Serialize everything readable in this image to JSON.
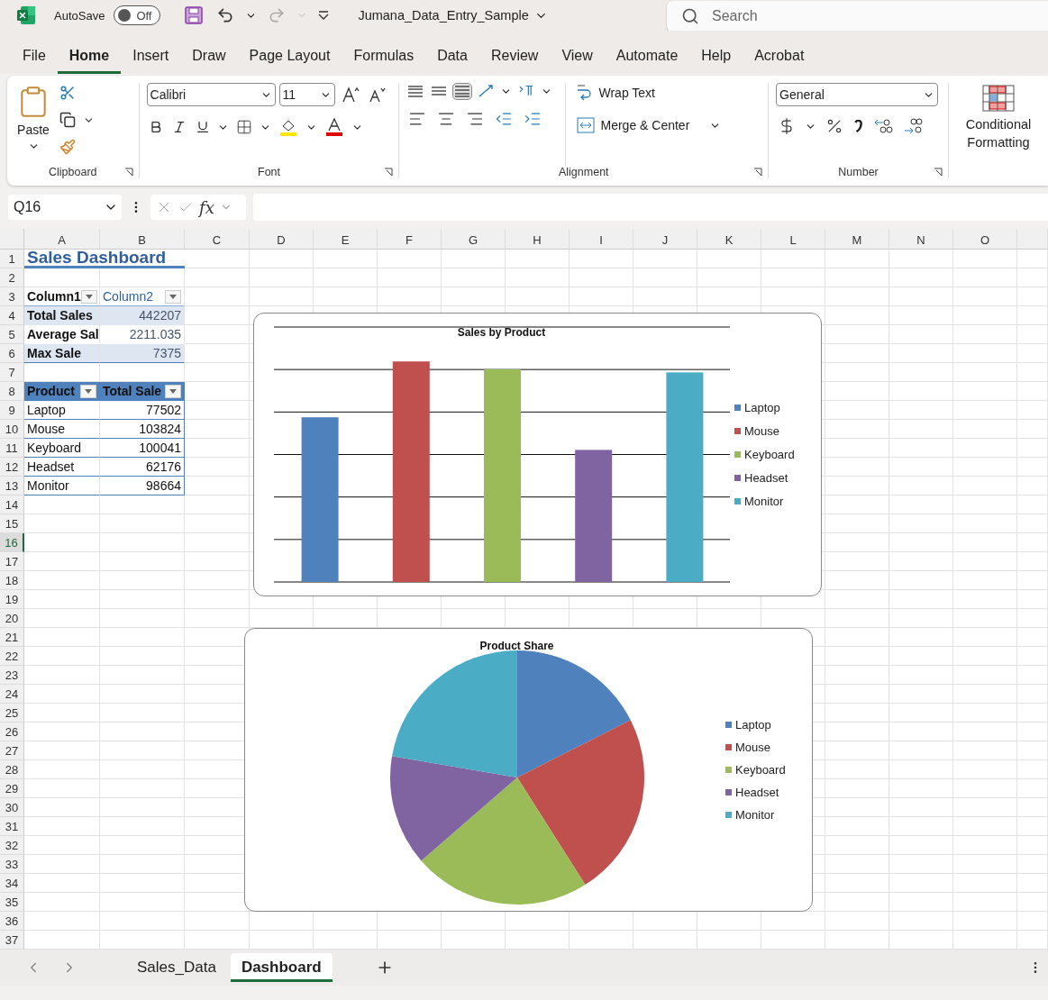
{
  "title_bar": {
    "autosave": {
      "label": "AutoSave",
      "on": false,
      "state_label": "Off"
    },
    "file_name": "Jumana_Data_Entry_Sample",
    "search": {
      "placeholder": "Search"
    }
  },
  "menu_tabs": [
    {
      "label": "File",
      "selected": false
    },
    {
      "label": "Home",
      "selected": true
    },
    {
      "label": "Insert",
      "selected": false
    },
    {
      "label": "Draw",
      "selected": false
    },
    {
      "label": "Page Layout",
      "selected": false
    },
    {
      "label": "Formulas",
      "selected": false
    },
    {
      "label": "Data",
      "selected": false
    },
    {
      "label": "Review",
      "selected": false
    },
    {
      "label": "View",
      "selected": false
    },
    {
      "label": "Automate",
      "selected": false
    },
    {
      "label": "Help",
      "selected": false
    },
    {
      "label": "Acrobat",
      "selected": false
    }
  ],
  "ribbon": {
    "clipboard": {
      "paste_label": "Paste",
      "group_label": "Clipboard"
    },
    "font": {
      "font_name": "Calibri",
      "font_size": "11",
      "group_label": "Font"
    },
    "alignment": {
      "vertical_align": [
        {
          "selected": false
        },
        {
          "selected": false
        },
        {
          "selected": true
        }
      ],
      "wrap_text": "Wrap Text",
      "merge_center": "Merge & Center",
      "group_label": "Alignment"
    },
    "number": {
      "format": "General",
      "group_label": "Number"
    },
    "styles": {
      "conditional_formatting": "Conditional Formatting"
    }
  },
  "formula_bar": {
    "name_box": "Q16",
    "function_label": "fx"
  },
  "sheet": {
    "columns": [
      "A",
      "B",
      "C",
      "D",
      "E",
      "F",
      "G",
      "H",
      "I",
      "J",
      "K",
      "L",
      "M",
      "N",
      "O"
    ],
    "rows": [
      {
        "label": "1",
        "selected": false
      },
      {
        "label": "2",
        "selected": false
      },
      {
        "label": "3",
        "selected": false
      },
      {
        "label": "4",
        "selected": false
      },
      {
        "label": "5",
        "selected": false
      },
      {
        "label": "6",
        "selected": false
      },
      {
        "label": "7",
        "selected": false
      },
      {
        "label": "8",
        "selected": false
      },
      {
        "label": "9",
        "selected": false
      },
      {
        "label": "10",
        "selected": false
      },
      {
        "label": "11",
        "selected": false
      },
      {
        "label": "12",
        "selected": false
      },
      {
        "label": "13",
        "selected": false
      },
      {
        "label": "14",
        "selected": false
      },
      {
        "label": "15",
        "selected": false
      },
      {
        "label": "16",
        "selected": true
      },
      {
        "label": "17",
        "selected": false
      },
      {
        "label": "18",
        "selected": false
      },
      {
        "label": "19",
        "selected": false
      },
      {
        "label": "20",
        "selected": false
      },
      {
        "label": "21",
        "selected": false
      },
      {
        "label": "22",
        "selected": false
      },
      {
        "label": "23",
        "selected": false
      },
      {
        "label": "24",
        "selected": false
      },
      {
        "label": "25",
        "selected": false
      },
      {
        "label": "26",
        "selected": false
      },
      {
        "label": "27",
        "selected": false
      },
      {
        "label": "28",
        "selected": false
      },
      {
        "label": "29",
        "selected": false
      },
      {
        "label": "30",
        "selected": false
      },
      {
        "label": "31",
        "selected": false
      },
      {
        "label": "32",
        "selected": false
      },
      {
        "label": "33",
        "selected": false
      },
      {
        "label": "34",
        "selected": false
      },
      {
        "label": "35",
        "selected": false
      },
      {
        "label": "36",
        "selected": false
      },
      {
        "label": "37",
        "selected": false
      }
    ],
    "dashboard_title": "Sales Dashboard",
    "summary_table": {
      "columns": [
        "Column1",
        "Column2"
      ],
      "rows": [
        [
          "Total Sales",
          "442207"
        ],
        [
          "Average Sal",
          "2211.035"
        ],
        [
          "Max Sale",
          "7375"
        ]
      ]
    },
    "product_table": {
      "columns": [
        "Product",
        "Total Sale"
      ],
      "rows": [
        [
          "Laptop",
          "77502"
        ],
        [
          "Mouse",
          "103824"
        ],
        [
          "Keyboard",
          "100041"
        ],
        [
          "Headset",
          "62176"
        ],
        [
          "Monitor",
          "98664"
        ]
      ]
    }
  },
  "bar_chart": {
    "title": "Sales by Product",
    "legend": [
      {
        "label": "Laptop",
        "color": "#4f81bd"
      },
      {
        "label": "Mouse",
        "color": "#c0504d"
      },
      {
        "label": "Keyboard",
        "color": "#9bbb59"
      },
      {
        "label": "Headset",
        "color": "#8064a2"
      },
      {
        "label": "Monitor",
        "color": "#4bacc6"
      }
    ]
  },
  "pie_chart": {
    "chart_data": {
      "type": "pie",
      "title": "Product Share",
      "legend": "right",
      "categories": [
        "Laptop",
        "Mouse",
        "Keyboard",
        "Headset",
        "Monitor"
      ],
      "values": [
        17.53,
        23.48,
        22.62,
        14.06,
        22.31
      ]
    },
    "slices": [
      {
        "color": "#4f81bd"
      },
      {
        "color": "#c0504d"
      },
      {
        "color": "#9bbb59"
      },
      {
        "color": "#8064a2"
      },
      {
        "color": "#4bacc6"
      }
    ]
  },
  "sheet_tabs": [
    {
      "label": "Sales_Data",
      "selected": false
    },
    {
      "label": "Dashboard",
      "selected": true
    }
  ]
}
